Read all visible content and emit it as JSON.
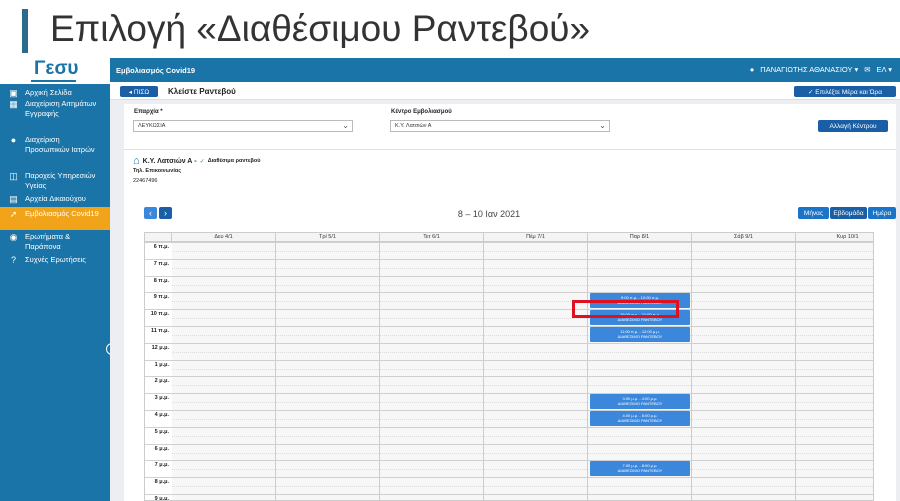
{
  "slide": {
    "title": "Επιλογή «Διαθέσιμου Ραντεβού»"
  },
  "logo": {
    "text": "Γεσυ"
  },
  "sidebar": {
    "items": [
      {
        "label": "Αρχική Σελίδα",
        "icon": "home-icon"
      },
      {
        "label": "Διαχείριση Αιτημάτων Εγγραφής",
        "icon": "document-icon"
      },
      {
        "label": "Διαχείριση Προσωπικών Ιατρών",
        "icon": "doctor-icon"
      },
      {
        "label": "Παροχείς Υπηρεσιών Υγείας",
        "icon": "hospital-icon"
      },
      {
        "label": "Αρχεία Δικαιούχου",
        "icon": "id-card-icon"
      },
      {
        "label": "Εμβολιασμός Covid19",
        "icon": "syringe-icon",
        "active": true
      },
      {
        "label": "Ερωτήματα & Παράπονα",
        "icon": "chat-icon"
      },
      {
        "label": "Συχνές Ερωτήσεις",
        "icon": "help-icon"
      }
    ]
  },
  "topbar": {
    "app": "Εμβολιασμός Covid19",
    "user": "ΠΑΝΑΓΙΩΤΗΣ ΑΘΑΝΑΣΙΟΥ ▾",
    "lang": "ΕΛ ▾"
  },
  "header": {
    "back": "◂ ΠΙΣΩ",
    "title": "Κλείστε Ραντεβού",
    "pick": "✓ Επιλέξτε Μέρα και Ώρα"
  },
  "form": {
    "province_label": "Επαρχία *",
    "province_value": "ΛΕΥΚΩΣΙΑ",
    "center_label": "Κέντρο Εμβολιασμού",
    "center_value": "Κ.Υ. Λατσιών Α",
    "change_btn": "Αλλαγή Κέντρου"
  },
  "center": {
    "name": "Κ.Υ. Λατσιών Α -",
    "avail": "Διαθέσιμα ραντεβού",
    "phone_label": "Τηλ. Επικοινωνίας",
    "phone": "22467496"
  },
  "calendar": {
    "range": "8 – 10 Ιαν 2021",
    "prev": "‹",
    "next": "›",
    "views": [
      "Μήνας",
      "Εβδομάδα",
      "Ημέρα"
    ],
    "days": [
      "Δευ 4/1",
      "Τρί 5/1",
      "Τετ 6/1",
      "Πέμ 7/1",
      "Παρ 8/1",
      "Σάβ 9/1",
      "Κυρ 10/1"
    ],
    "hours": [
      "6 π.μ.",
      "7 π.μ.",
      "8 π.μ.",
      "9 π.μ.",
      "10 π.μ.",
      "11 π.μ.",
      "12 μ.μ.",
      "1 μ.μ.",
      "2 μ.μ.",
      "3 μ.μ.",
      "4 μ.μ.",
      "5 μ.μ.",
      "6 μ.μ.",
      "7 μ.μ.",
      "8 μ.μ.",
      "9 μ.μ."
    ],
    "events": [
      {
        "day": 4,
        "start": 9,
        "time": "9:00 π.μ. - 10:00 π.μ.",
        "label": "ΔΙΑΘΕΣΙΜΟ ΡΑΝΤΕΒΟΥ"
      },
      {
        "day": 4,
        "start": 10,
        "time": "10:00 π.μ. - 11:00 π.μ.",
        "label": "ΔΙΑΘΕΣΙΜΟ ΡΑΝΤΕΒΟΥ"
      },
      {
        "day": 4,
        "start": 11,
        "time": "11:00 π.μ. - 12:00 μ.μ.",
        "label": "ΔΙΑΘΕΣΙΜΟ ΡΑΝΤΕΒΟΥ"
      },
      {
        "day": 4,
        "start": 15,
        "time": "3:00 μ.μ. - 4:00 μ.μ.",
        "label": "ΔΙΑΘΕΣΙΜΟ ΡΑΝΤΕΒΟΥ"
      },
      {
        "day": 4,
        "start": 16,
        "time": "4:00 μ.μ. - 5:00 μ.μ.",
        "label": "ΔΙΑΘΕΣΙΜΟ ΡΑΝΤΕΒΟΥ"
      },
      {
        "day": 4,
        "start": 19,
        "time": "7:00 μ.μ. - 8:00 μ.μ.",
        "label": "ΔΙΑΘΕΣΙΜΟ ΡΑΝΤΕΒΟΥ"
      }
    ]
  }
}
